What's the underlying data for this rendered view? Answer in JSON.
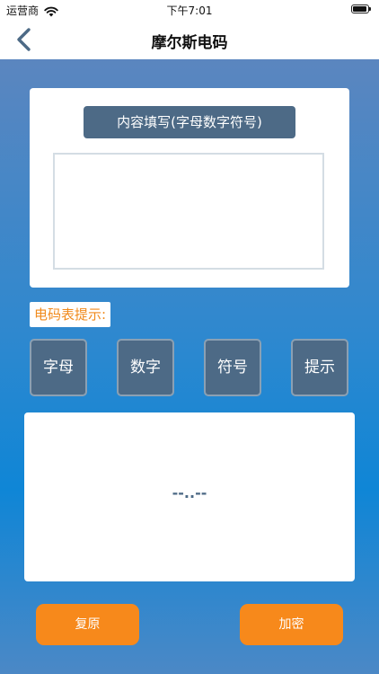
{
  "status_bar": {
    "carrier": "运营商",
    "time": "下午7:01"
  },
  "nav": {
    "title": "摩尔斯电码",
    "back_icon": "chevron-left-icon"
  },
  "input": {
    "label": "内容填写(字母数字符号)",
    "value": "",
    "placeholder": ""
  },
  "hint": {
    "label": "电码表提示:"
  },
  "categories": [
    {
      "label": "字母"
    },
    {
      "label": "数字"
    },
    {
      "label": "符号"
    },
    {
      "label": "提示"
    }
  ],
  "output": {
    "text": "--..--"
  },
  "actions": {
    "reset_label": "复原",
    "encrypt_label": "加密"
  },
  "colors": {
    "accent": "#f7891b",
    "panel": "#4d6a86",
    "hint_text": "#f08a1c"
  }
}
